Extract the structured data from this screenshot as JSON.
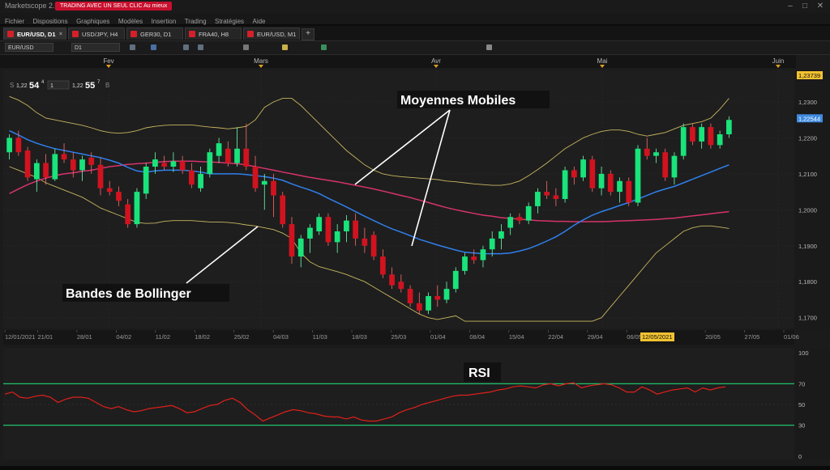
{
  "window": {
    "app_title": "Marketscope 2.0",
    "promo": "TRADING AVEC UN SEUL CLIC Au mieux",
    "controls": [
      "–",
      "□",
      "✕"
    ]
  },
  "menu": [
    "Fichier",
    "Dispositions",
    "Graphiques",
    "Modèles",
    "Insertion",
    "Trading",
    "Stratégies",
    "Aide"
  ],
  "tabs": [
    {
      "label": "EUR/USD, D1",
      "active": true
    },
    {
      "label": "USD/JPY, H4",
      "active": false
    },
    {
      "label": "GER30, D1",
      "active": false
    },
    {
      "label": "FRA40, H8",
      "active": false
    },
    {
      "label": "EUR/USD, M1",
      "active": false
    }
  ],
  "add_tab": "+",
  "toolbar": {
    "instrument": "EUR/USD",
    "timeframe": "D1",
    "icons": [
      "bar-chart-icon",
      "draw-icon",
      "zoom-in-icon",
      "zoom-out-icon",
      "crosshair-icon",
      "indicator-icon",
      "line-icon",
      "settings-icon"
    ]
  },
  "quote": {
    "sell_prefix": "S",
    "sell_big": "1,22",
    "sell_pips": "54",
    "sell_frac": "4",
    "amount": "1",
    "buy_big": "1,22",
    "buy_pips": "55",
    "buy_frac": "7",
    "buy_suffix": "B"
  },
  "chart_data": {
    "type": "candlestick",
    "instrument": "EUR/USD",
    "timeframe": "D1",
    "months": [
      "Fev",
      "Mars",
      "Avr",
      "Mai",
      "Juin"
    ],
    "x_dates": [
      "12/01/2021",
      "21/01",
      "28/01",
      "04/02",
      "11/02",
      "18/02",
      "25/02",
      "04/03",
      "11/03",
      "18/03",
      "25/03",
      "01/04",
      "08/04",
      "15/04",
      "22/04",
      "29/04",
      "06/05",
      "12/05/2021",
      "20/05",
      "27/05",
      "01/06"
    ],
    "y_ticks": [
      "1,2300",
      "1,2200",
      "1,2100",
      "1,2000",
      "1,1900",
      "1,1800",
      "1,1700"
    ],
    "ylim": [
      1.167,
      1.239
    ],
    "price_top": "1,23739",
    "price_current": "1,22544",
    "candles": [
      [
        1.216,
        1.221,
        1.214,
        1.22
      ],
      [
        1.22,
        1.222,
        1.215,
        1.216
      ],
      [
        1.2165,
        1.2175,
        1.208,
        1.209
      ],
      [
        1.2085,
        1.214,
        1.205,
        1.213
      ],
      [
        1.213,
        1.2155,
        1.207,
        1.209
      ],
      [
        1.2085,
        1.217,
        1.208,
        1.2155
      ],
      [
        1.2155,
        1.2185,
        1.213,
        1.214
      ],
      [
        1.214,
        1.216,
        1.209,
        1.211
      ],
      [
        1.211,
        1.215,
        1.208,
        1.214
      ],
      [
        1.2145,
        1.216,
        1.21,
        1.2125
      ],
      [
        1.2125,
        1.2145,
        1.204,
        1.206
      ],
      [
        1.206,
        1.208,
        1.204,
        1.205
      ],
      [
        1.205,
        1.2065,
        1.201,
        1.2025
      ],
      [
        1.2015,
        1.203,
        1.195,
        1.196
      ],
      [
        1.196,
        1.206,
        1.195,
        1.205
      ],
      [
        1.2045,
        1.213,
        1.203,
        1.212
      ],
      [
        1.212,
        1.216,
        1.21,
        1.214
      ],
      [
        1.213,
        1.215,
        1.211,
        1.212
      ],
      [
        1.212,
        1.216,
        1.2105,
        1.2135
      ],
      [
        1.2135,
        1.215,
        1.21,
        1.211
      ],
      [
        1.211,
        1.213,
        1.206,
        1.207
      ],
      [
        1.206,
        1.212,
        1.205,
        1.21
      ],
      [
        1.21,
        1.217,
        1.209,
        1.216
      ],
      [
        1.215,
        1.22,
        1.213,
        1.2185
      ],
      [
        1.217,
        1.219,
        1.212,
        1.213
      ],
      [
        1.213,
        1.223,
        1.212,
        1.217
      ],
      [
        1.217,
        1.224,
        1.211,
        1.212
      ],
      [
        1.212,
        1.215,
        1.205,
        1.206
      ],
      [
        1.207,
        1.21,
        1.2,
        1.208
      ],
      [
        1.208,
        1.21,
        1.198,
        1.204
      ],
      [
        1.204,
        1.205,
        1.195,
        1.196
      ],
      [
        1.196,
        1.198,
        1.185,
        1.187
      ],
      [
        1.187,
        1.193,
        1.184,
        1.192
      ],
      [
        1.192,
        1.196,
        1.188,
        1.195
      ],
      [
        1.194,
        1.199,
        1.193,
        1.198
      ],
      [
        1.198,
        1.199,
        1.19,
        1.191
      ],
      [
        1.191,
        1.196,
        1.188,
        1.194
      ],
      [
        1.194,
        1.1985,
        1.191,
        1.197
      ],
      [
        1.197,
        1.199,
        1.19,
        1.192
      ],
      [
        1.192,
        1.195,
        1.188,
        1.19
      ],
      [
        1.193,
        1.194,
        1.186,
        1.187
      ],
      [
        1.187,
        1.189,
        1.181,
        1.182
      ],
      [
        1.182,
        1.184,
        1.178,
        1.179
      ],
      [
        1.18,
        1.182,
        1.177,
        1.178
      ],
      [
        1.178,
        1.179,
        1.173,
        1.174
      ],
      [
        1.174,
        1.177,
        1.171,
        1.172
      ],
      [
        1.172,
        1.177,
        1.171,
        1.176
      ],
      [
        1.176,
        1.179,
        1.173,
        1.175
      ],
      [
        1.175,
        1.18,
        1.174,
        1.178
      ],
      [
        1.178,
        1.184,
        1.177,
        1.183
      ],
      [
        1.183,
        1.188,
        1.182,
        1.187
      ],
      [
        1.187,
        1.189,
        1.185,
        1.186
      ],
      [
        1.186,
        1.19,
        1.184,
        1.189
      ],
      [
        1.189,
        1.194,
        1.187,
        1.192
      ],
      [
        1.192,
        1.196,
        1.189,
        1.194
      ],
      [
        1.195,
        1.199,
        1.193,
        1.198
      ],
      [
        1.198,
        1.199,
        1.196,
        1.197
      ],
      [
        1.197,
        1.202,
        1.196,
        1.201
      ],
      [
        1.201,
        1.206,
        1.199,
        1.205
      ],
      [
        1.205,
        1.208,
        1.203,
        1.204
      ],
      [
        1.204,
        1.206,
        1.201,
        1.203
      ],
      [
        1.203,
        1.212,
        1.202,
        1.211
      ],
      [
        1.211,
        1.212,
        1.207,
        1.209
      ],
      [
        1.209,
        1.215,
        1.208,
        1.214
      ],
      [
        1.214,
        1.215,
        1.205,
        1.206
      ],
      [
        1.206,
        1.212,
        1.204,
        1.21
      ],
      [
        1.21,
        1.211,
        1.204,
        1.205
      ],
      [
        1.205,
        1.209,
        1.202,
        1.208
      ],
      [
        1.208,
        1.209,
        1.201,
        1.202
      ],
      [
        1.202,
        1.218,
        1.201,
        1.217
      ],
      [
        1.217,
        1.22,
        1.214,
        1.215
      ],
      [
        1.215,
        1.217,
        1.213,
        1.216
      ],
      [
        1.216,
        1.217,
        1.208,
        1.209
      ],
      [
        1.209,
        1.216,
        1.207,
        1.215
      ],
      [
        1.215,
        1.224,
        1.214,
        1.223
      ],
      [
        1.223,
        1.224,
        1.218,
        1.219
      ],
      [
        1.219,
        1.224,
        1.217,
        1.223
      ],
      [
        1.223,
        1.224,
        1.217,
        1.218
      ],
      [
        1.218,
        1.222,
        1.217,
        1.221
      ],
      [
        1.221,
        1.226,
        1.22,
        1.225
      ]
    ],
    "series": [
      {
        "name": "MA20",
        "color": "#2f80ed",
        "values": [
          1.222,
          1.2208,
          1.2195,
          1.2185,
          1.2177,
          1.217,
          1.2165,
          1.216,
          1.2155,
          1.215,
          1.2145,
          1.2138,
          1.213,
          1.2118,
          1.2108,
          1.2105,
          1.2108,
          1.211,
          1.211,
          1.211,
          1.2108,
          1.2105,
          1.21,
          1.21,
          1.21,
          1.21,
          1.2098,
          1.2095,
          1.2092,
          1.2088,
          1.2082,
          1.2072,
          1.2063,
          1.2055,
          1.2045,
          1.2032,
          1.202,
          1.2008,
          1.1995,
          1.1982,
          1.197,
          1.1958,
          1.1947,
          1.1938,
          1.1928,
          1.1918,
          1.191,
          1.1902,
          1.1895,
          1.1888,
          1.1882,
          1.188,
          1.1878,
          1.1878,
          1.1878,
          1.188,
          1.1885,
          1.1892,
          1.1902,
          1.1913,
          1.1925,
          1.194,
          1.1957,
          1.1972,
          1.1985,
          1.1995,
          1.2003,
          1.2012,
          1.202,
          1.203,
          1.204,
          1.205,
          1.2058,
          1.2065,
          1.2075,
          1.2085,
          1.2095,
          1.2105,
          1.2115,
          1.2125
        ]
      },
      {
        "name": "MA50",
        "color": "#d6336c",
        "values": [
          1.2045,
          1.2058,
          1.207,
          1.208,
          1.2088,
          1.2095,
          1.21,
          1.2103,
          1.2107,
          1.211,
          1.2115,
          1.212,
          1.2123,
          1.2126,
          1.2128,
          1.213,
          1.2132,
          1.2134,
          1.2135,
          1.2135,
          1.2135,
          1.2134,
          1.2133,
          1.2132,
          1.213,
          1.2128,
          1.2125,
          1.212,
          1.2115,
          1.211,
          1.2105,
          1.21,
          1.2095,
          1.209,
          1.2086,
          1.2082,
          1.2078,
          1.2073,
          1.2068,
          1.2063,
          1.2058,
          1.2052,
          1.2046,
          1.204,
          1.2034,
          1.2027,
          1.202,
          1.2013,
          1.2006,
          1.2,
          1.1995,
          1.199,
          1.1985,
          1.1982,
          1.1978,
          1.1976,
          1.1974,
          1.1972,
          1.197,
          1.1969,
          1.1968,
          1.1968,
          1.1967,
          1.1967,
          1.1967,
          1.1967,
          1.1968,
          1.1969,
          1.197,
          1.1971,
          1.1972,
          1.1973,
          1.1975,
          1.1977,
          1.198,
          1.1983,
          1.1986,
          1.1989,
          1.1992,
          1.1995
        ]
      },
      {
        "name": "BB upper",
        "color": "#c8b560",
        "values": [
          1.2315,
          1.2305,
          1.229,
          1.227,
          1.2255,
          1.225,
          1.2245,
          1.224,
          1.2235,
          1.2228,
          1.222,
          1.2215,
          1.2213,
          1.2215,
          1.222,
          1.2228,
          1.2232,
          1.2235,
          1.2236,
          1.2236,
          1.2236,
          1.2233,
          1.223,
          1.2228,
          1.2225,
          1.2228,
          1.2232,
          1.225,
          1.2285,
          1.23,
          1.231,
          1.231,
          1.229,
          1.2265,
          1.224,
          1.2215,
          1.219,
          1.2165,
          1.2145,
          1.2125,
          1.211,
          1.21,
          1.2095,
          1.2092,
          1.209,
          1.2088,
          1.2086,
          1.2084,
          1.208,
          1.2078,
          1.2075,
          1.2072,
          1.207,
          1.2068,
          1.2068,
          1.2072,
          1.208,
          1.2095,
          1.2112,
          1.213,
          1.215,
          1.217,
          1.2185,
          1.22,
          1.221,
          1.2218,
          1.2222,
          1.2222,
          1.2218,
          1.221,
          1.2205,
          1.221,
          1.2215,
          1.2225,
          1.2235,
          1.224,
          1.2245,
          1.2255,
          1.228,
          1.231
        ]
      },
      {
        "name": "BB lower",
        "color": "#c8b560",
        "values": [
          1.212,
          1.211,
          1.21,
          1.209,
          1.2075,
          1.2065,
          1.2055,
          1.2045,
          1.2035,
          1.202,
          1.2005,
          1.1995,
          1.1985,
          1.1975,
          1.1965,
          1.1962,
          1.1963,
          1.1968,
          1.197,
          1.197,
          1.197,
          1.1968,
          1.1966,
          1.1966,
          1.1965,
          1.1962,
          1.1958,
          1.1955,
          1.195,
          1.1945,
          1.1935,
          1.192,
          1.188,
          1.1855,
          1.1842,
          1.1835,
          1.1828,
          1.182,
          1.181,
          1.18,
          1.1785,
          1.177,
          1.1755,
          1.174,
          1.1725,
          1.171,
          1.17,
          1.1695,
          1.17,
          1.1705,
          1.169,
          1.169,
          1.169,
          1.169,
          1.169,
          1.169,
          1.169,
          1.169,
          1.169,
          1.169,
          1.169,
          1.169,
          1.169,
          1.169,
          1.169,
          1.17,
          1.173,
          1.176,
          1.179,
          1.182,
          1.185,
          1.188,
          1.19,
          1.192,
          1.194,
          1.195,
          1.1955,
          1.1955,
          1.1952,
          1.1948
        ]
      }
    ],
    "rsi": {
      "name": "RSI",
      "color": "#e0201a",
      "levels": [
        30,
        50,
        70
      ],
      "level_color": "#1fc26b",
      "y_ticks": [
        "100",
        "70",
        "50",
        "30",
        "0"
      ],
      "ylim": [
        0,
        100
      ],
      "values": [
        60,
        62,
        57,
        56,
        58,
        59,
        57,
        52,
        55,
        57,
        57,
        56,
        52,
        48,
        46,
        48,
        45,
        43,
        44,
        46,
        47,
        48,
        49,
        46,
        42,
        43,
        46,
        49,
        50,
        54,
        56,
        52,
        45,
        40,
        34,
        37,
        40,
        43,
        45,
        44,
        42,
        41,
        39,
        38,
        38,
        36,
        38,
        35,
        34,
        34,
        36,
        38,
        42,
        45,
        47,
        50,
        52,
        54,
        56,
        58,
        59,
        59,
        60,
        61,
        62,
        64,
        65,
        67,
        68,
        67,
        66,
        69,
        70,
        68,
        70,
        71,
        66,
        68,
        69,
        70,
        69,
        66,
        62,
        62,
        67,
        64,
        60,
        62,
        64,
        65,
        66,
        62,
        66,
        64,
        66,
        67
      ]
    },
    "annotations": [
      "Moyennes Mobiles",
      "Bandes de Bollinger",
      "RSI"
    ],
    "crosshair_date": "12/05/2021"
  }
}
